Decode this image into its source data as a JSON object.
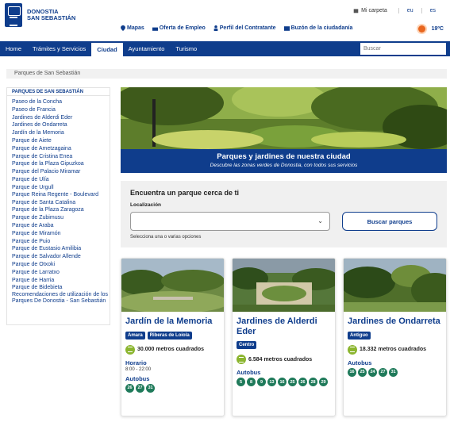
{
  "header": {
    "logo_line1": "DONOSTIA",
    "logo_line2": "SAN SEBASTIÁN",
    "mi_carpeta": "Mi carpeta",
    "lang_eu": "eu",
    "lang_es": "es",
    "util_links": [
      "Mapas",
      "Oferta de Empleo",
      "Perfil del Contratante",
      "Buzón de la ciudadanía"
    ],
    "temperature": "19ºC"
  },
  "nav": {
    "items": [
      "Home",
      "Trámites y Servicios",
      "Ciudad",
      "Ayuntamiento",
      "Turismo"
    ],
    "active": "Ciudad",
    "search_placeholder": "Buscar"
  },
  "breadcrumb": "Parques de San Sebastián",
  "sidebar": {
    "title": "PARQUES DE SAN SEBASTIÁN",
    "items": [
      "Paseo de la Concha",
      "Paseo de Francia",
      "Jardines de Alderdi Eder",
      "Jardines de Ondarreta",
      "Jardín de la Memoria",
      "Parque de Aiete",
      "Parque de Ametzagaina",
      "Parque de Cristina Enea",
      "Parque de la Plaza Gipuzkoa",
      "Parque del Palacio Miramar",
      "Parque de Ulía",
      "Parque de Urgull",
      "Parque Reina Regente - Boulevard",
      "Parque de Santa Catalina",
      "Parque de la Plaza Zaragoza",
      "Parque de Zubimusu",
      "Parque de Araba",
      "Parque de Miramón",
      "Parque de Puio",
      "Parque de Eustasio Amilibia",
      "Parque de Salvador Allende",
      "Parque de Otxoki",
      "Parque de Larratxo",
      "Parque de Harria",
      "Parque de Bidebieta",
      "Recomendaciones de utilización de los Parques De Donostia - San Sebastián"
    ]
  },
  "hero": {
    "title": "Parques y jardines de nuestra ciudad",
    "subtitle": "Descubre las zonas verdes de Donostia, con todos sus servicios"
  },
  "finder": {
    "title": "Encuentra un parque cerca de ti",
    "location_label": "Localización",
    "location_value": "",
    "hint": "Selecciona una o varias opciones",
    "button": "Buscar parques"
  },
  "cards": [
    {
      "title": "Jardín de la Memoria",
      "tags": [
        "Amara",
        "Riberas de Loiola"
      ],
      "area": "30.000 metros cuadrados",
      "horario_label": "Horario",
      "horario": "8:00 - 22:00",
      "bus_label": "Autobus",
      "buses": [
        "26",
        "27",
        "31"
      ]
    },
    {
      "title": "Jardines de Alderdi Eder",
      "tags": [
        "Centro"
      ],
      "area": "6.584 metros cuadrados",
      "bus_label": "Autobus",
      "buses": [
        "5",
        "8",
        "9",
        "13",
        "16",
        "25",
        "26",
        "28",
        "29"
      ]
    },
    {
      "title": "Jardines de Ondarreta",
      "tags": [
        "Antiguo"
      ],
      "area": "18.332 metros cuadrados",
      "bus_label": "Autobus",
      "buses": [
        "16",
        "25",
        "24",
        "27",
        "31"
      ]
    }
  ],
  "colors": {
    "brand_blue": "#0f3d8c",
    "bus_green": "#1f7a5a",
    "area_green": "#8bb52f"
  }
}
